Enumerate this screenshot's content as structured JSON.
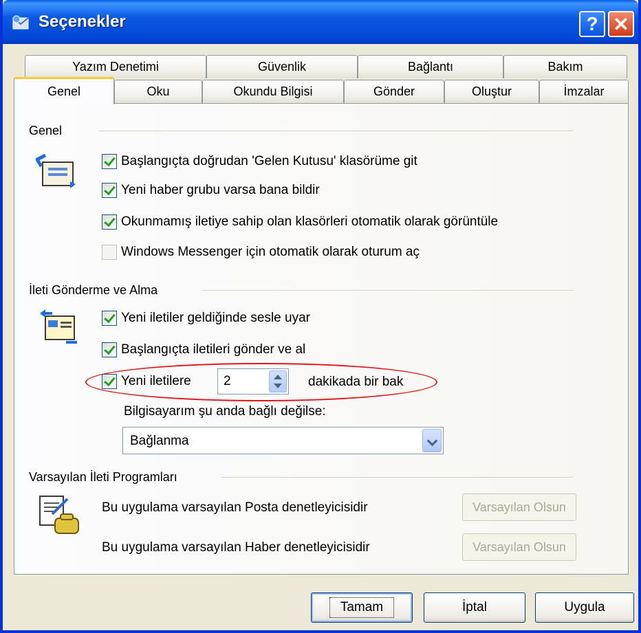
{
  "window": {
    "title": "Seçenekler",
    "help_glyph": "?",
    "close_glyph": "✕"
  },
  "tabs_back": [
    "Yazım Denetimi",
    "Güvenlik",
    "Bağlantı",
    "Bakım"
  ],
  "tabs_front": [
    "Genel",
    "Oku",
    "Okundu Bilgisi",
    "Gönder",
    "Oluştur",
    "İmzalar"
  ],
  "active_tab": "Genel",
  "groups": {
    "genel": {
      "label": "Genel",
      "options": [
        {
          "label": "Başlangıçta doğrudan 'Gelen Kutusu' klasörüme git",
          "checked": true
        },
        {
          "label": "Yeni haber grubu varsa bana bildir",
          "checked": true
        },
        {
          "label": "Okunmamış iletiye sahip olan klasörleri otomatik olarak görüntüle",
          "checked": true
        },
        {
          "label": "Windows Messenger için otomatik olarak oturum aç",
          "checked": false
        }
      ]
    },
    "ileti": {
      "label": "İleti Gönderme ve Alma",
      "options": [
        {
          "label": "Yeni iletiler geldiğinde sesle uyar",
          "checked": true
        },
        {
          "label": "Başlangıçta iletileri gönder ve al",
          "checked": true
        }
      ],
      "interval": {
        "before": "Yeni iletilere",
        "value": "2",
        "after": "dakikada bir bak",
        "checked": true
      },
      "offline_label": "Bilgisayarım şu anda bağlı değilse:",
      "offline_select": "Bağlanma"
    },
    "varsayilan": {
      "label": "Varsayılan İleti Programları",
      "mail_text": "Bu uygulama varsayılan Posta denetleyicisidir",
      "news_text": "Bu uygulama varsayılan Haber denetleyicisidir",
      "default_button": "Varsayılan Olsun"
    }
  },
  "buttons": {
    "ok": "Tamam",
    "cancel": "İptal",
    "apply": "Uygula"
  },
  "colors": {
    "titlebar": "#0a58e3",
    "highlight_ellipse": "#e01818",
    "check": "#21a121"
  }
}
